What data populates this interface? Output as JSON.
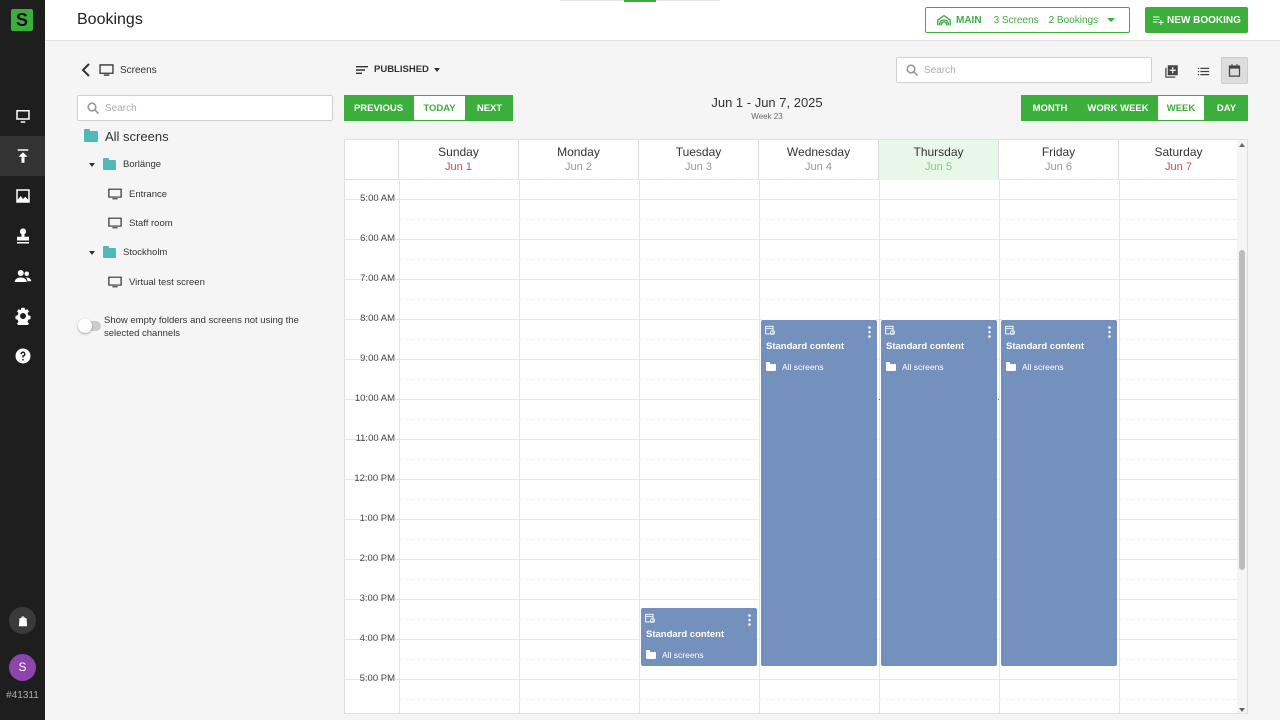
{
  "app": {
    "title": "Bookings",
    "logo_letter": "S",
    "account_id": "#41311",
    "avatar_letter": "S"
  },
  "rail": {
    "items": [
      {
        "icon": "monitor-icon",
        "active": false
      },
      {
        "icon": "upload-icon",
        "active": true
      },
      {
        "icon": "image-icon",
        "active": false
      },
      {
        "icon": "stamp-icon",
        "active": false
      },
      {
        "icon": "users-icon",
        "active": false
      },
      {
        "icon": "gear-icon",
        "active": false
      },
      {
        "icon": "help-icon",
        "active": false
      }
    ]
  },
  "header": {
    "channel": {
      "name": "MAIN",
      "screens": "3 Screens",
      "bookings": "2 Bookings"
    },
    "new_booking_label": "NEW BOOKING"
  },
  "left": {
    "crumb_label": "Screens",
    "search_placeholder": "Search",
    "root_label": "All screens",
    "groups": [
      {
        "label": "Borlänge",
        "screens": [
          "Entrance",
          "Staff room"
        ]
      },
      {
        "label": "Stockholm",
        "screens": [
          "Virtual test screen"
        ]
      }
    ],
    "toggle_label": "Show empty folders and screens not using the selected channels"
  },
  "toolbar": {
    "filter_label": "PUBLISHED",
    "previous_label": "PREVIOUS",
    "today_label": "TODAY",
    "next_label": "NEXT",
    "range": "Jun 1 - Jun 7, 2025",
    "week": "Week 23",
    "views": [
      {
        "label": "MONTH",
        "active": false
      },
      {
        "label": "WORK WEEK",
        "active": false
      },
      {
        "label": "WEEK",
        "active": true
      },
      {
        "label": "DAY",
        "active": false
      }
    ],
    "search_placeholder": "Search"
  },
  "calendar": {
    "days": [
      {
        "name": "Sunday",
        "date": "Jun 1",
        "weekend": true,
        "today": false
      },
      {
        "name": "Monday",
        "date": "Jun 2",
        "weekend": false,
        "today": false
      },
      {
        "name": "Tuesday",
        "date": "Jun 3",
        "weekend": false,
        "today": false
      },
      {
        "name": "Wednesday",
        "date": "Jun 4",
        "weekend": false,
        "today": false
      },
      {
        "name": "Thursday",
        "date": "Jun 5",
        "weekend": false,
        "today": true
      },
      {
        "name": "Friday",
        "date": "Jun 6",
        "weekend": false,
        "today": false
      },
      {
        "name": "Saturday",
        "date": "Jun 7",
        "weekend": true,
        "today": false
      }
    ],
    "hours": [
      "5:00 AM",
      "6:00 AM",
      "7:00 AM",
      "8:00 AM",
      "9:00 AM",
      "10:00 AM",
      "11:00 AM",
      "12:00 PM",
      "1:00 PM",
      "2:00 PM",
      "3:00 PM",
      "4:00 PM",
      "5:00 PM"
    ],
    "first_hour": 5,
    "now_time": 10.0,
    "events": [
      {
        "day": 2,
        "start": 15.2,
        "end": 16.7,
        "title": "Standard content",
        "location": "All screens"
      },
      {
        "day": 3,
        "start": 8.0,
        "end": 16.7,
        "title": "Standard content",
        "location": "All screens"
      },
      {
        "day": 4,
        "start": 8.0,
        "end": 16.7,
        "title": "Standard content",
        "location": "All screens"
      },
      {
        "day": 5,
        "start": 8.0,
        "end": 16.7,
        "title": "Standard content",
        "location": "All screens"
      }
    ]
  },
  "colors": {
    "accent": "#3cae3c",
    "event": "#7490bd",
    "now_line": "#e03030",
    "today_bg": "#e8f8e8"
  }
}
